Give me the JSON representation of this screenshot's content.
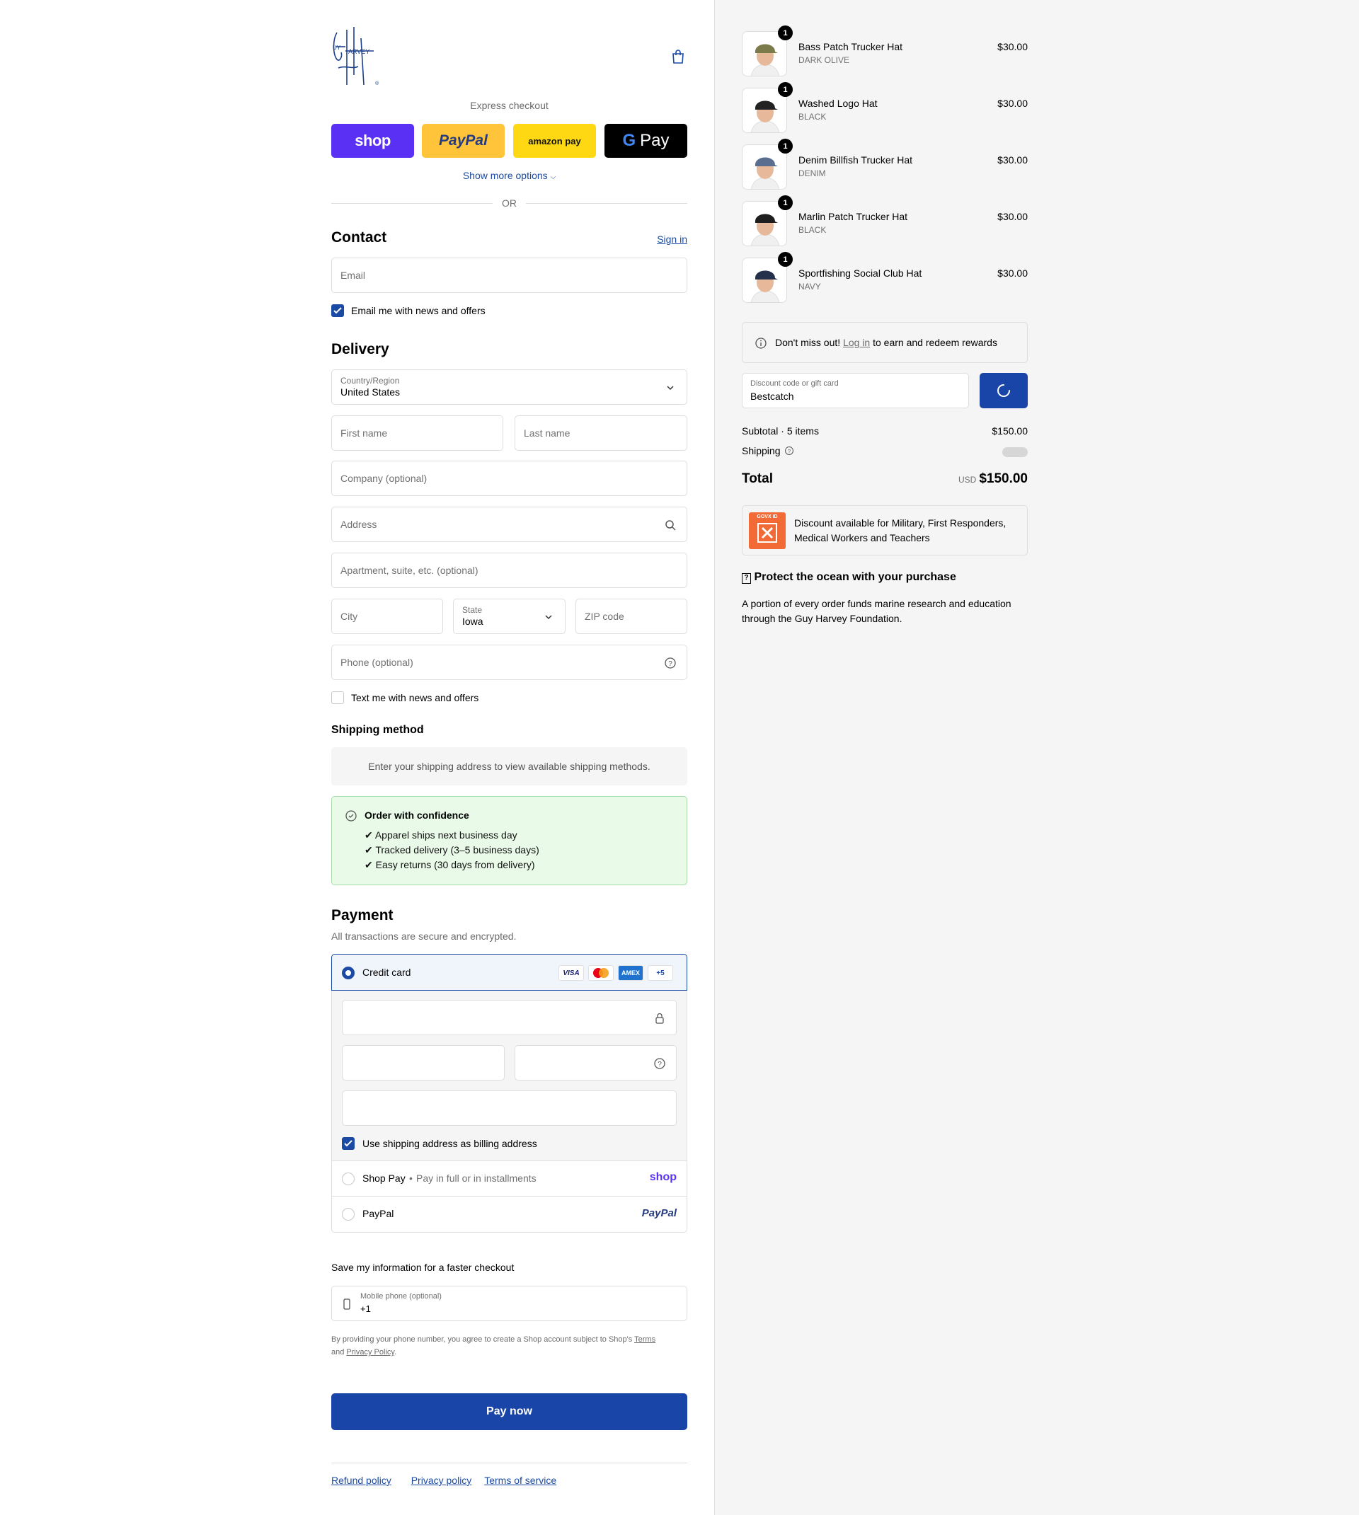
{
  "header": {
    "express_label": "Express checkout",
    "express_buttons": {
      "shop": "shop",
      "paypal": "PayPal",
      "amazon": "amazon pay",
      "gpay": "Pay"
    },
    "show_more": "Show more options",
    "or": "OR"
  },
  "contact": {
    "title": "Contact",
    "sign_in": "Sign in",
    "email_placeholder": "Email",
    "news_checkbox": "Email me with news and offers"
  },
  "delivery": {
    "title": "Delivery",
    "country_label": "Country/Region",
    "country_value": "United States",
    "first_name": "First name",
    "last_name": "Last name",
    "company": "Company (optional)",
    "address": "Address",
    "apartment": "Apartment, suite, etc. (optional)",
    "city": "City",
    "state_label": "State",
    "state_value": "Iowa",
    "zip": "ZIP code",
    "phone": "Phone (optional)",
    "text_checkbox": "Text me with news and offers"
  },
  "shipping_method": {
    "title": "Shipping method",
    "note": "Enter your shipping address to view available shipping methods."
  },
  "confidence": {
    "title": "Order with confidence",
    "items": [
      "✔ Apparel ships next business day",
      "✔ Tracked delivery (3–5 business days)",
      "✔ Easy returns (30 days from delivery)"
    ]
  },
  "payment": {
    "title": "Payment",
    "subtitle": "All transactions are secure and encrypted.",
    "credit_card": "Credit card",
    "badges": [
      "VISA",
      "",
      "AMEX",
      "+5"
    ],
    "billing_checkbox": "Use shipping address as billing address",
    "shop_pay": "Shop Pay",
    "shop_pay_note": "Pay in full or in installments",
    "shop_pay_brand": "shop",
    "paypal": "PayPal",
    "paypal_brand": "PayPal"
  },
  "save_info": {
    "title": "Save my information for a faster checkout",
    "mobile_label": "Mobile phone (optional)",
    "mobile_value": "+1",
    "legal_1": "By providing your phone number, you agree to create a Shop account subject to Shop's",
    "legal_terms": "Terms",
    "legal_and": "and",
    "legal_privacy": "Privacy Policy",
    "legal_end": "."
  },
  "pay_now": "Pay now",
  "footer": {
    "refund": "Refund policy",
    "privacy": "Privacy policy",
    "terms": "Terms of service"
  },
  "cart": {
    "items": [
      {
        "name": "Bass Patch Trucker Hat",
        "variant": "DARK OLIVE",
        "price": "$30.00",
        "qty": "1",
        "cap_color": "#7a7a4a"
      },
      {
        "name": "Washed Logo Hat",
        "variant": "BLACK",
        "price": "$30.00",
        "qty": "1",
        "cap_color": "#222222"
      },
      {
        "name": "Denim Billfish Trucker Hat",
        "variant": "DENIM",
        "price": "$30.00",
        "qty": "1",
        "cap_color": "#5a6f8f"
      },
      {
        "name": "Marlin Patch Trucker Hat",
        "variant": "BLACK",
        "price": "$30.00",
        "qty": "1",
        "cap_color": "#1e1e1e"
      },
      {
        "name": "Sportfishing Social Club Hat",
        "variant": "NAVY",
        "price": "$30.00",
        "qty": "1",
        "cap_color": "#25304a"
      }
    ],
    "rewards_pre": "Don't miss out!",
    "rewards_link": "Log in",
    "rewards_post": "to earn and redeem rewards",
    "discount_label": "Discount code or gift card",
    "discount_value": "Bestcatch",
    "subtotal_label": "Subtotal · 5 items",
    "subtotal_value": "$150.00",
    "shipping_label": "Shipping",
    "total_label": "Total",
    "total_currency": "USD",
    "total_value": "$150.00",
    "govx_badge": "GOVX ID",
    "govx_text_1": "Discount available for Military, First Responders,",
    "govx_text_2": "Medical Workers and Teachers",
    "protect_title": "Protect the ocean with your purchase",
    "protect_text": "A portion of every order funds marine research and education through the Guy Harvey Foundation."
  },
  "colors": {
    "accent": "#1a4aa3",
    "button": "#1a45a8",
    "shop": "#5a31f4",
    "paypal": "#ffc439",
    "amazon": "#ffd814"
  }
}
